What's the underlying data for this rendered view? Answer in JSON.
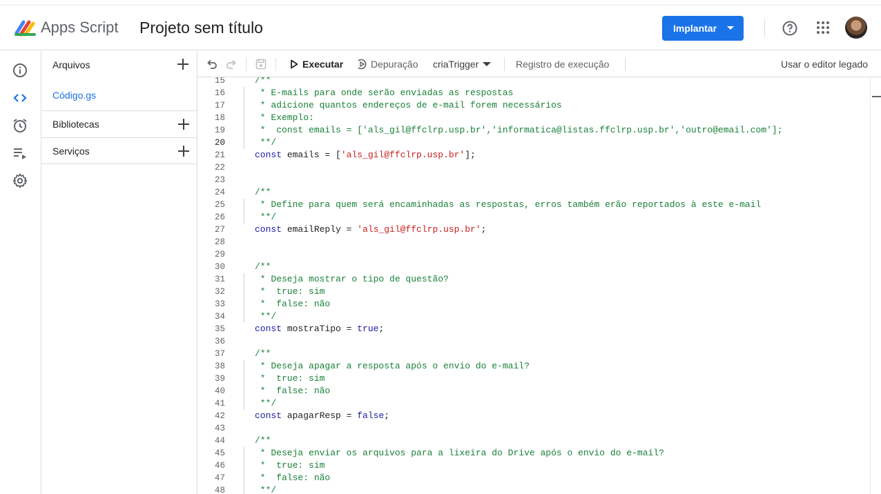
{
  "header": {
    "app_name": "Apps Script",
    "project_title": "Projeto sem título",
    "deploy_label": "Implantar",
    "accent_color": "#1a73e8"
  },
  "rail": {
    "icons": [
      "info-icon",
      "code-icon",
      "clock-icon",
      "executions-icon",
      "gear-icon"
    ]
  },
  "files_panel": {
    "title": "Arquivos",
    "files": [
      "Código.gs"
    ],
    "libraries_label": "Bibliotecas",
    "services_label": "Serviços"
  },
  "toolbar": {
    "run_label": "Executar",
    "debug_label": "Depuração",
    "function_selector": "criaTrigger",
    "log_label": "Registro de execução",
    "legacy_label": "Usar o editor legado"
  },
  "editor": {
    "active_line": "20",
    "lines": [
      {
        "n": "15",
        "text": "/**"
      },
      {
        "n": "16",
        "text": " * E-mails para onde serão enviadas as respostas"
      },
      {
        "n": "17",
        "text": " * adicione quantos endereços de e-mail forem necessários"
      },
      {
        "n": "18",
        "text": " * Exemplo:"
      },
      {
        "n": "19",
        "text": " *  const emails = ['als_gil@ffclrp.usp.br','informatica@listas.ffclrp.usp.br','outro@email.com'];"
      },
      {
        "n": "20",
        "text": " **/"
      },
      {
        "n": "21",
        "kw": "const",
        "rest1": " emails = [",
        "str": "'als_gil@ffclrp.usp.br'",
        "rest2": "];"
      },
      {
        "n": "22",
        "text": ""
      },
      {
        "n": "23",
        "text": ""
      },
      {
        "n": "24",
        "text": "/**"
      },
      {
        "n": "25",
        "text": " * Define para quem será encaminhadas as respostas, erros também erão reportados à este e-mail"
      },
      {
        "n": "26",
        "text": " **/"
      },
      {
        "n": "27",
        "kw": "const",
        "rest1": " emailReply = ",
        "str": "'als_gil@ffclrp.usp.br'",
        "rest2": ";"
      },
      {
        "n": "28",
        "text": ""
      },
      {
        "n": "29",
        "text": ""
      },
      {
        "n": "30",
        "text": "/**"
      },
      {
        "n": "31",
        "text": " * Deseja mostrar o tipo de questão?"
      },
      {
        "n": "32",
        "text": " *  true: sim"
      },
      {
        "n": "33",
        "text": " *  false: não"
      },
      {
        "n": "34",
        "text": " **/"
      },
      {
        "n": "35",
        "kw": "const",
        "rest1": " mostraTipo = ",
        "bool": "true",
        "rest2": ";"
      },
      {
        "n": "36",
        "text": ""
      },
      {
        "n": "37",
        "text": "/**"
      },
      {
        "n": "38",
        "text": " * Deseja apagar a resposta após o envio do e-mail?"
      },
      {
        "n": "39",
        "text": " *  true: sim"
      },
      {
        "n": "40",
        "text": " *  false: não"
      },
      {
        "n": "41",
        "text": " **/"
      },
      {
        "n": "42",
        "kw": "const",
        "rest1": " apagarResp = ",
        "bool": "false",
        "rest2": ";"
      },
      {
        "n": "43",
        "text": ""
      },
      {
        "n": "44",
        "text": "/**"
      },
      {
        "n": "45",
        "text": " * Deseja enviar os arquivos para a lixeira do Drive após o envio do e-mail?"
      },
      {
        "n": "46",
        "text": " *  true: sim"
      },
      {
        "n": "47",
        "text": " *  false: não"
      },
      {
        "n": "48",
        "text": " **/"
      }
    ]
  }
}
